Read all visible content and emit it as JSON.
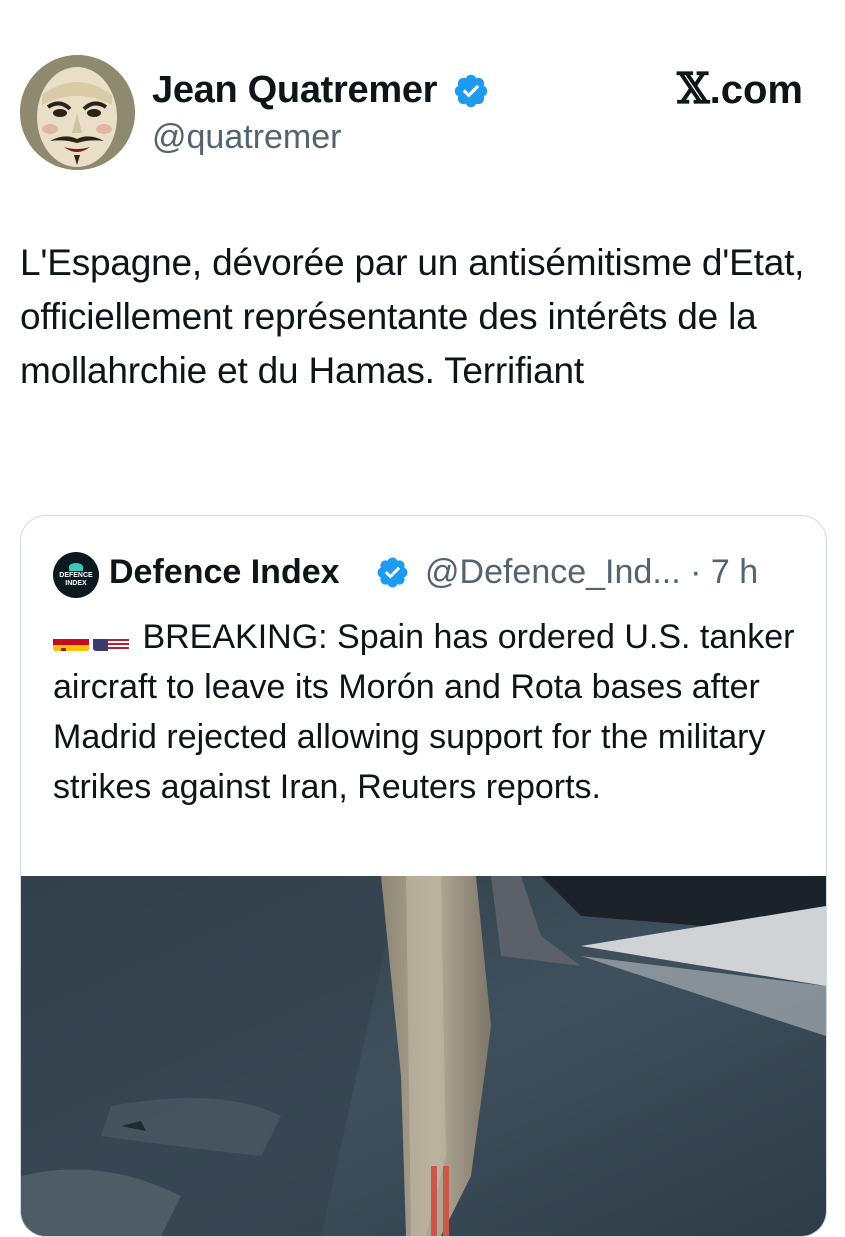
{
  "author": {
    "display_name": "Jean Quatremer",
    "handle": "@quatremer",
    "avatar_icon": "masked-face-avatar",
    "verified_icon": "verified-badge-icon"
  },
  "brand": {
    "text": ".com",
    "glyph": "𝕏"
  },
  "tweet": {
    "text": "L'Espagne, dévorée par un antisémitisme d'Etat, officiellement représentante des intérêts de la mollahrchie et du Hamas. Terrifiant"
  },
  "quote": {
    "display_name": "Defence Index",
    "logo_text": "DEFENCE INDEX",
    "handle_time": "@Defence_Ind... · 7 h",
    "flags": [
      "spain-flag-icon",
      "usa-flag-icon"
    ],
    "text": "BREAKING: Spain has ordered U.S. tanker aircraft to leave its Morón and Rota bases after Madrid rejected allowing support for the military strikes against Iran, Reuters reports.",
    "media_description": "refueling-boom-photo"
  },
  "colors": {
    "verified": "#1d9bf0",
    "text": "#0f1419",
    "secondary": "#536471",
    "border": "#cfd9de"
  }
}
